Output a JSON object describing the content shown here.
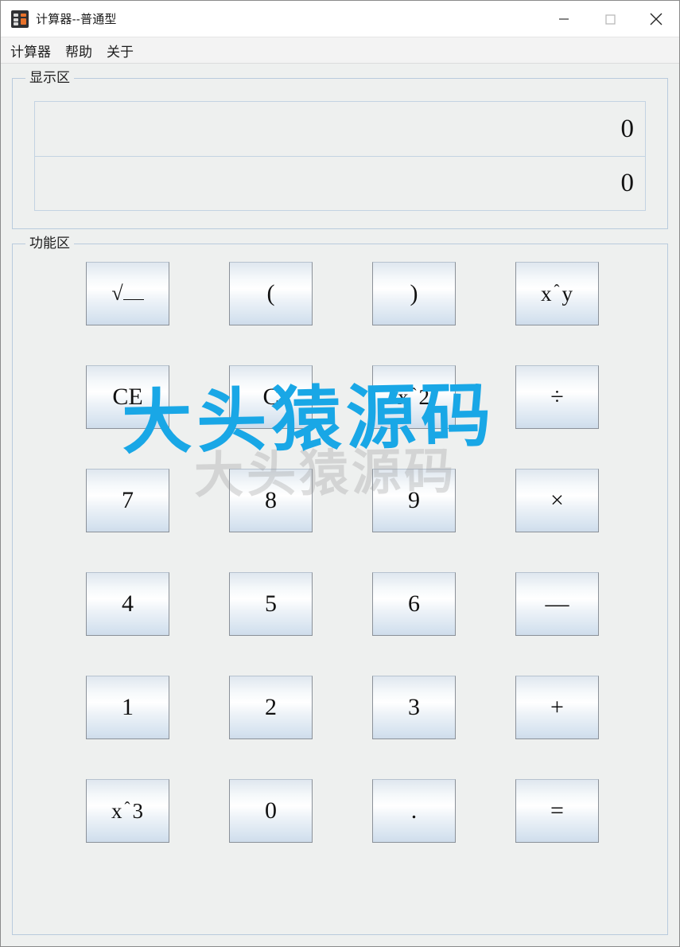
{
  "window": {
    "title": "计算器--普通型",
    "icon": "calculator-icon",
    "controls": {
      "minimize": "minimize-icon",
      "maximize": "maximize-icon",
      "close": "close-icon"
    }
  },
  "menubar": {
    "items": [
      {
        "label": "计算器"
      },
      {
        "label": "帮助"
      },
      {
        "label": "关于"
      }
    ]
  },
  "display": {
    "group_label": "显示区",
    "primary_value": "0",
    "secondary_value": "0"
  },
  "keypad": {
    "group_label": "功能区",
    "rows": [
      [
        {
          "name": "sqrt",
          "label": "√",
          "type": "sqrt"
        },
        {
          "name": "paren-open",
          "label": "(",
          "type": "text"
        },
        {
          "name": "paren-close",
          "label": ")",
          "type": "text"
        },
        {
          "name": "power-y",
          "label": "x^y",
          "type": "power",
          "base": "x",
          "exp": "y"
        }
      ],
      [
        {
          "name": "clear-entry",
          "label": "CE",
          "type": "text"
        },
        {
          "name": "clear",
          "label": "C",
          "type": "text"
        },
        {
          "name": "power-2",
          "label": "x^2",
          "type": "power",
          "base": "x",
          "exp": "2"
        },
        {
          "name": "divide",
          "label": "÷",
          "type": "text"
        }
      ],
      [
        {
          "name": "digit-7",
          "label": "7",
          "type": "text"
        },
        {
          "name": "digit-8",
          "label": "8",
          "type": "text"
        },
        {
          "name": "digit-9",
          "label": "9",
          "type": "text"
        },
        {
          "name": "multiply",
          "label": "×",
          "type": "text"
        }
      ],
      [
        {
          "name": "digit-4",
          "label": "4",
          "type": "text"
        },
        {
          "name": "digit-5",
          "label": "5",
          "type": "text"
        },
        {
          "name": "digit-6",
          "label": "6",
          "type": "text"
        },
        {
          "name": "subtract",
          "label": "—",
          "type": "text"
        }
      ],
      [
        {
          "name": "digit-1",
          "label": "1",
          "type": "text"
        },
        {
          "name": "digit-2",
          "label": "2",
          "type": "text"
        },
        {
          "name": "digit-3",
          "label": "3",
          "type": "text"
        },
        {
          "name": "add",
          "label": "+",
          "type": "text"
        }
      ],
      [
        {
          "name": "power-3",
          "label": "x^3",
          "type": "power",
          "base": "x",
          "exp": "3"
        },
        {
          "name": "digit-0",
          "label": "0",
          "type": "text"
        },
        {
          "name": "decimal",
          "label": ".",
          "type": "text"
        },
        {
          "name": "equals",
          "label": "=",
          "type": "text"
        }
      ]
    ]
  },
  "watermarks": {
    "primary": {
      "text": "大头猿源码",
      "color": "#19a7e6"
    },
    "secondary": {
      "text": "大头猿源码",
      "color": "#969696"
    }
  }
}
